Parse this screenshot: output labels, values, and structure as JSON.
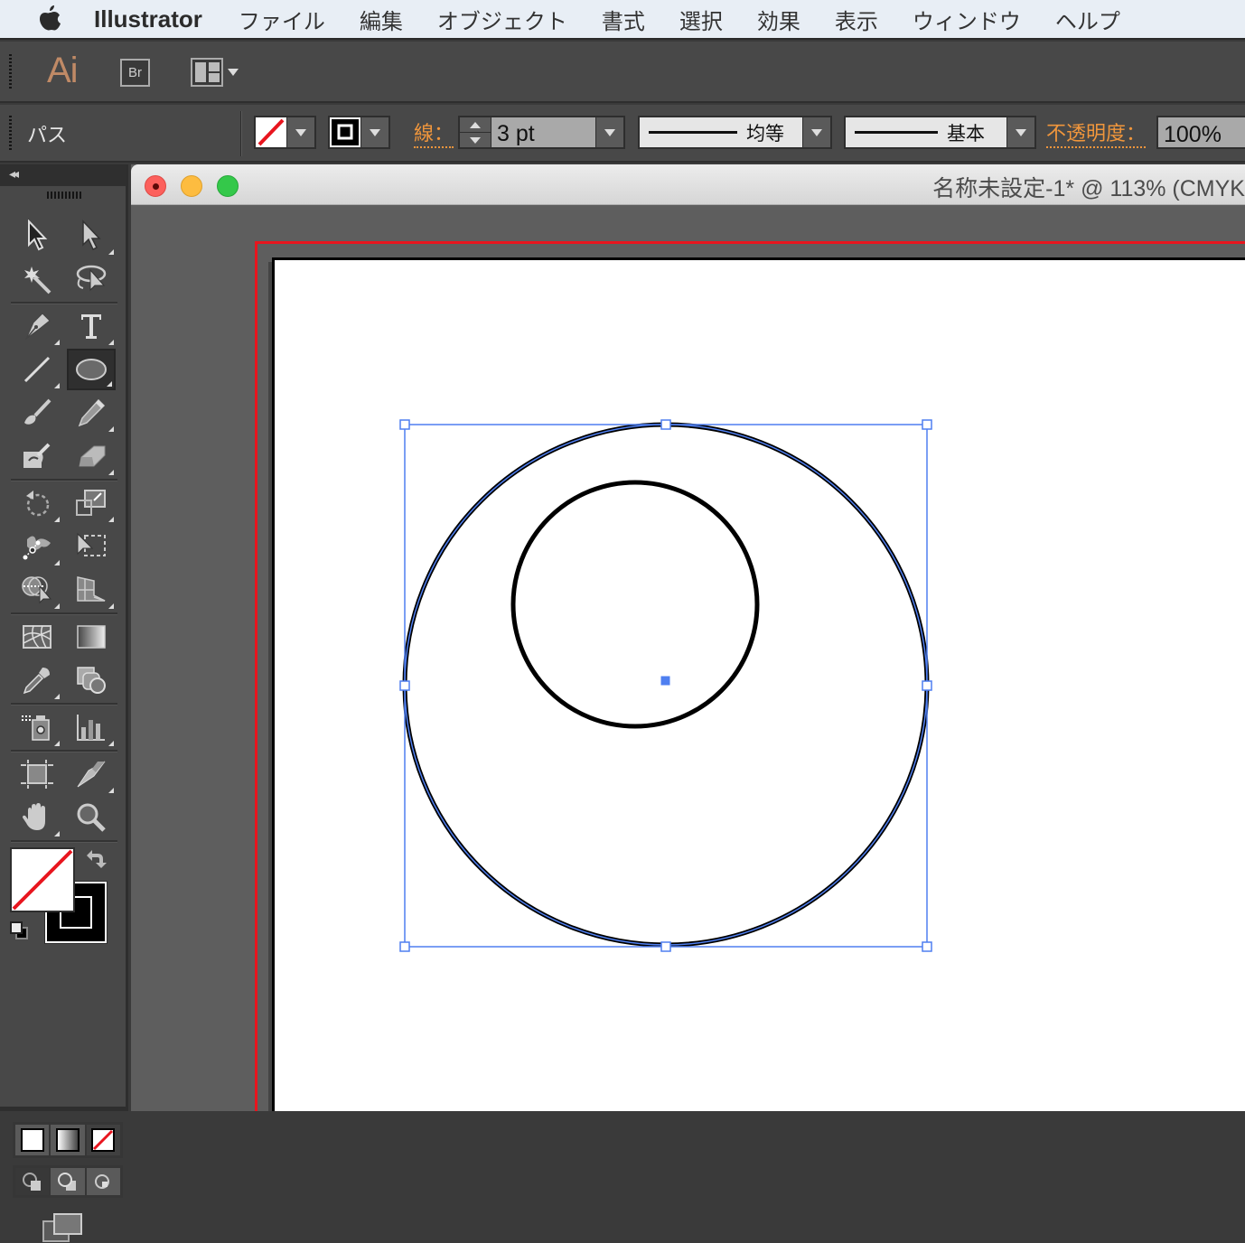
{
  "menubar": {
    "apple_icon": "apple-logo-icon",
    "app_name": "Illustrator",
    "items": [
      "ファイル",
      "編集",
      "オブジェクト",
      "書式",
      "選択",
      "効果",
      "表示",
      "ウィンドウ",
      "ヘルプ"
    ]
  },
  "appbar": {
    "logo": "Ai",
    "bridge_label": "Br",
    "workspace_icon": "layout-switcher-icon"
  },
  "control_bar": {
    "selection_type": "パス",
    "fill_swatch": "none",
    "stroke_swatch": "black",
    "stroke_label": "線：",
    "stroke_weight": "3 pt",
    "variable_width_profile": "均等",
    "brush_definition": "基本",
    "opacity_label": "不透明度：",
    "opacity_value": "100%"
  },
  "toolbox": {
    "collapse_label": "◂◂",
    "tools": [
      {
        "name": "selection-tool",
        "icon": "arrow-black"
      },
      {
        "name": "direct-selection-tool",
        "icon": "arrow-white"
      },
      {
        "name": "magic-wand-tool",
        "icon": "magic-wand"
      },
      {
        "name": "lasso-tool",
        "icon": "lasso"
      },
      {
        "name": "pen-tool",
        "icon": "pen"
      },
      {
        "name": "type-tool",
        "icon": "type-T"
      },
      {
        "name": "line-segment-tool",
        "icon": "line"
      },
      {
        "name": "ellipse-tool",
        "icon": "ellipse",
        "active": true
      },
      {
        "name": "paintbrush-tool",
        "icon": "brush"
      },
      {
        "name": "pencil-tool",
        "icon": "pencil"
      },
      {
        "name": "blob-brush-tool",
        "icon": "blob-brush"
      },
      {
        "name": "eraser-tool",
        "icon": "eraser"
      },
      {
        "name": "rotate-tool",
        "icon": "rotate"
      },
      {
        "name": "scale-tool",
        "icon": "scale"
      },
      {
        "name": "width-tool",
        "icon": "width"
      },
      {
        "name": "free-transform-tool",
        "icon": "free-transform"
      },
      {
        "name": "shape-builder-tool",
        "icon": "shape-builder"
      },
      {
        "name": "perspective-grid-tool",
        "icon": "perspective-grid"
      },
      {
        "name": "mesh-tool",
        "icon": "mesh"
      },
      {
        "name": "gradient-tool",
        "icon": "gradient"
      },
      {
        "name": "eyedropper-tool",
        "icon": "eyedropper"
      },
      {
        "name": "blend-tool",
        "icon": "blend"
      },
      {
        "name": "symbol-sprayer-tool",
        "icon": "symbol-sprayer"
      },
      {
        "name": "column-graph-tool",
        "icon": "column-graph"
      },
      {
        "name": "artboard-tool",
        "icon": "artboard"
      },
      {
        "name": "slice-tool",
        "icon": "slice"
      },
      {
        "name": "hand-tool",
        "icon": "hand"
      },
      {
        "name": "zoom-tool",
        "icon": "magnifier"
      }
    ],
    "fill_stroke": {
      "fill": "none",
      "stroke": "black"
    },
    "color_modes": [
      "color",
      "gradient",
      "none"
    ],
    "draw_modes": [
      "draw-normal",
      "draw-behind",
      "draw-inside"
    ],
    "screen_mode_icon": "screen-mode-icon"
  },
  "document": {
    "title": "名称未設定-1* @ 113% (CMYK",
    "zoom": "113%",
    "colors": {
      "selection": "#4f7ff0",
      "artboard_bleed": "#e8151e",
      "canvas_bg": "#5e5e5e"
    },
    "objects": [
      {
        "type": "ellipse",
        "name": "outer-circle",
        "stroke": "#000000",
        "stroke_weight": "3 pt",
        "selected": true
      },
      {
        "type": "ellipse",
        "name": "inner-circle",
        "stroke": "#000000",
        "stroke_weight": "3 pt",
        "selected": false
      }
    ]
  }
}
